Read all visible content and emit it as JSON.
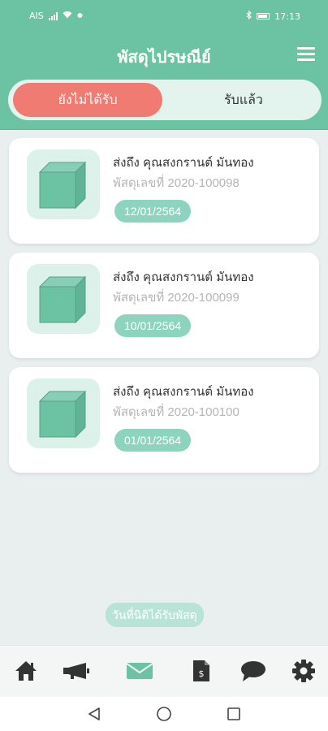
{
  "status_bar": {
    "carrier": "AIS",
    "time": "17:13"
  },
  "header": {
    "title": "พัสดุไปรษณีย์",
    "menu_icon": "hamburger-menu-icon"
  },
  "tabs": [
    {
      "label": "ยังไม่ได้รับ",
      "active": true
    },
    {
      "label": "รับแล้ว",
      "active": false
    }
  ],
  "parcels": [
    {
      "recipient": "ส่งถึง คุณสงกรานต์ มันทอง",
      "parcel_no": "พัสดุเลขที่ 2020-100098",
      "date": "12/01/2564"
    },
    {
      "recipient": "ส่งถึง คุณสงกรานต์ มันทอง",
      "parcel_no": "พัสดุเลขที่ 2020-100099",
      "date": "10/01/2564"
    },
    {
      "recipient": "ส่งถึง คุณสงกรานต์ มันทอง",
      "parcel_no": "พัสดุเลขที่ 2020-100100",
      "date": "01/01/2564"
    }
  ],
  "footer_note": "วันที่นิติได้รับพัสดุ",
  "bottom_nav": [
    {
      "icon": "home-icon"
    },
    {
      "icon": "megaphone-icon"
    },
    {
      "icon": "mail-icon",
      "active": true
    },
    {
      "icon": "document-icon"
    },
    {
      "icon": "chat-icon"
    },
    {
      "icon": "settings-icon"
    }
  ],
  "colors": {
    "primary": "#6cc3a4",
    "tab_active": "#ef7b72",
    "badge": "#8cd4bd",
    "nav_active": "#6cc3a4",
    "nav_icon": "#333333"
  }
}
